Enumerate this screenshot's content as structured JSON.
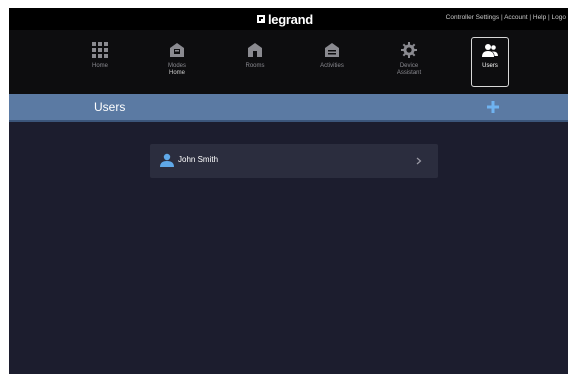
{
  "brand": {
    "name": "legrand"
  },
  "top_links": "Controller Settings | Account | Help | Logo",
  "nav": {
    "items": [
      {
        "label": "Home",
        "sub": "",
        "icon": "grid-icon",
        "active": false
      },
      {
        "label": "Modes",
        "sub": "Home",
        "icon": "modes-icon",
        "active": false
      },
      {
        "label": "Rooms",
        "sub": "",
        "icon": "rooms-icon",
        "active": false
      },
      {
        "label": "Activities",
        "sub": "",
        "icon": "activities-icon",
        "active": false
      },
      {
        "label": "Device",
        "sub": "Assistant",
        "icon": "gear-icon",
        "active": false
      },
      {
        "label": "Users",
        "sub": "",
        "icon": "users-icon",
        "active": true
      }
    ]
  },
  "header": {
    "title": "Users",
    "add_icon": "plus-icon"
  },
  "users": [
    {
      "name": "John Smith",
      "icon": "user-icon"
    }
  ],
  "colors": {
    "background": "#1c1d2e",
    "header": "#5b7aa3",
    "card": "#2b2d3e",
    "accent": "#5fa8e8"
  }
}
